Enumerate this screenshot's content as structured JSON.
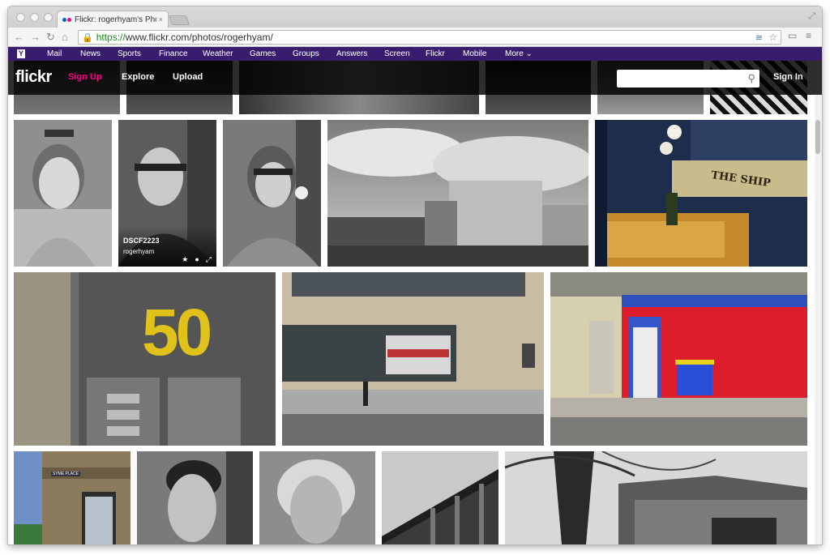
{
  "browser": {
    "tab_title": "Flickr: rogerhyam's Photo",
    "tab_close": "×",
    "url_scheme": "https://",
    "url_rest": "www.flickr.com/photos/rogerhyam/",
    "lock": "🔒"
  },
  "yahoo_bar": {
    "logo": "Y",
    "links": [
      "Mail",
      "News",
      "Sports",
      "Finance",
      "Weather",
      "Games",
      "Groups",
      "Answers",
      "Screen",
      "Flickr",
      "Mobile",
      "More ⌄"
    ]
  },
  "header": {
    "logo": "flickr",
    "sign_up": "Sign Up",
    "explore": "Explore",
    "upload": "Upload",
    "search_placeholder": "",
    "sign_in": "Sign In"
  },
  "hover_photo": {
    "title": "DSCF2223",
    "owner": "rogerhyam",
    "icons": [
      "star-icon",
      "comment-icon",
      "expand-icon"
    ]
  },
  "photo_texts": {
    "number_sign": "50",
    "ship_sign": "THE SHIP",
    "street_sign": "SYME PLACE"
  },
  "colors": {
    "yahoo_purple": "#3a1c6e",
    "flickr_pink": "#ff0084",
    "url_green": "#1c8a1f"
  }
}
